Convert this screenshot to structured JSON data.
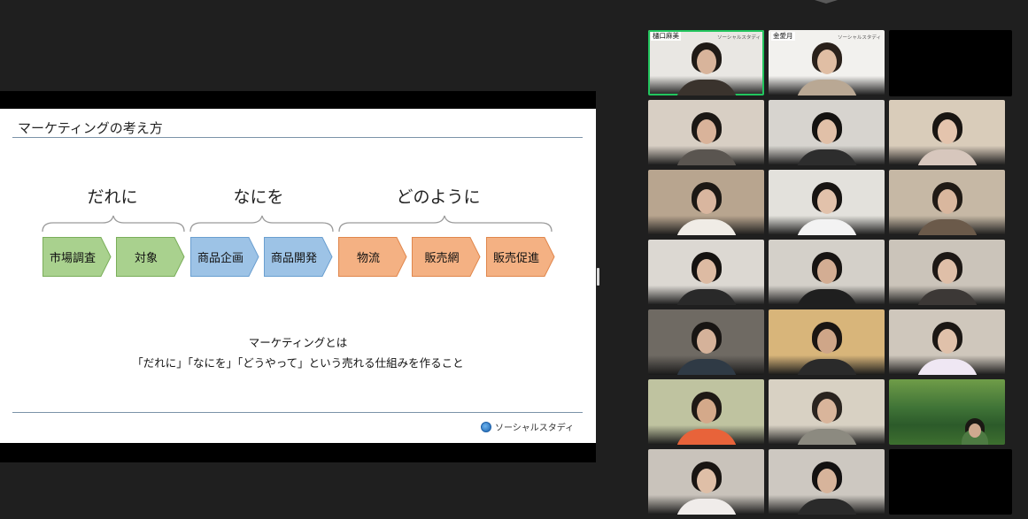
{
  "slide": {
    "title": "マーケティングの考え方",
    "groups": [
      "だれに",
      "なにを",
      "どのように"
    ],
    "steps": [
      {
        "label": "市場調査",
        "color": "#a9d18e",
        "border": "#7aae5a"
      },
      {
        "label": "対象",
        "color": "#a9d18e",
        "border": "#7aae5a"
      },
      {
        "label": "商品企画",
        "color": "#9dc3e6",
        "border": "#6a9fd0"
      },
      {
        "label": "商品開発",
        "color": "#9dc3e6",
        "border": "#6a9fd0"
      },
      {
        "label": "物流",
        "color": "#f4b183",
        "border": "#e0874d"
      },
      {
        "label": "販売網",
        "color": "#f4b183",
        "border": "#e0874d"
      },
      {
        "label": "販売促進",
        "color": "#f4b183",
        "border": "#e0874d"
      }
    ],
    "caption_line1": "マーケティングとは",
    "caption_line2": "「だれに」「なにを」「どうやって」という売れる仕組みを作ること",
    "brand": "ソーシャルスタディ"
  },
  "participants": [
    {
      "name": "樋口麻美",
      "bg": "#e9e7e3",
      "skin": "#d8b49b",
      "hair": "#1f1a16",
      "shirt": "#3a332d",
      "active": true,
      "brand": "ソーシャルスタディ"
    },
    {
      "name": "金愛月",
      "bg": "#f2f1ee",
      "skin": "#e0bea4",
      "hair": "#2a211b",
      "shirt": "#b9a894",
      "brand": "ソーシャルスタディ"
    },
    {
      "blank": true
    },
    {
      "bg": "#d8cfc4",
      "skin": "#d9b39a",
      "hair": "#1b1714",
      "shirt": "#5a5550"
    },
    {
      "bg": "#d7d4cf",
      "skin": "#e1c0a8",
      "hair": "#141210",
      "shirt": "#2d2d2d"
    },
    {
      "bg": "#d9ccba",
      "skin": "#e4c4ad",
      "hair": "#191512",
      "shirt": "#d7c7bd"
    },
    {
      "bg": "#b8a58f",
      "skin": "#d9b69f",
      "hair": "#1c1814",
      "shirt": "#f0ece6"
    },
    {
      "bg": "#e3e1dc",
      "skin": "#e2c2ab",
      "hair": "#171412",
      "shirt": "#f3f3f3"
    },
    {
      "bg": "#c6b8a5",
      "skin": "#d9b79e",
      "hair": "#201a15",
      "shirt": "#6b5a4a"
    },
    {
      "bg": "#dcd8d2",
      "skin": "#ddbba3",
      "hair": "#151210",
      "shirt": "#292929"
    },
    {
      "bg": "#d4d0c9",
      "skin": "#d3ad93",
      "hair": "#171412",
      "shirt": "#1f1f1f"
    },
    {
      "bg": "#cbc4ba",
      "skin": "#dfbfa8",
      "hair": "#1d1815",
      "shirt": "#3c3836"
    },
    {
      "bg": "#6f6a63",
      "skin": "#d5b29a",
      "hair": "#181513",
      "shirt": "#2f3a45"
    },
    {
      "bg": "#d8b57a",
      "skin": "#cfa688",
      "hair": "#1a1512",
      "shirt": "#2a2a2a"
    },
    {
      "bg": "#cfc7bc",
      "skin": "#e0c1aa",
      "hair": "#1b1714",
      "shirt": "#efe7f3"
    },
    {
      "bg": "#bfc3a0",
      "skin": "#d4a98a",
      "hair": "#1e1915",
      "shirt": "#e8633a"
    },
    {
      "bg": "#d8d1c3",
      "skin": "#d9b59b",
      "hair": "#2a241f",
      "shirt": "#8c8a80"
    },
    {
      "bg": "#3d6b3a",
      "skin": "#cfa98f",
      "hair": "#1b1814",
      "shirt": "#4d7a42",
      "forest": true
    },
    {
      "bg": "#c9c3bb",
      "skin": "#dfbfa7",
      "hair": "#191512",
      "shirt": "#f0ecea"
    },
    {
      "bg": "#cdc8c1",
      "skin": "#d7b49b",
      "hair": "#131111",
      "shirt": "#2a2a2a"
    },
    {
      "blank": true
    }
  ]
}
